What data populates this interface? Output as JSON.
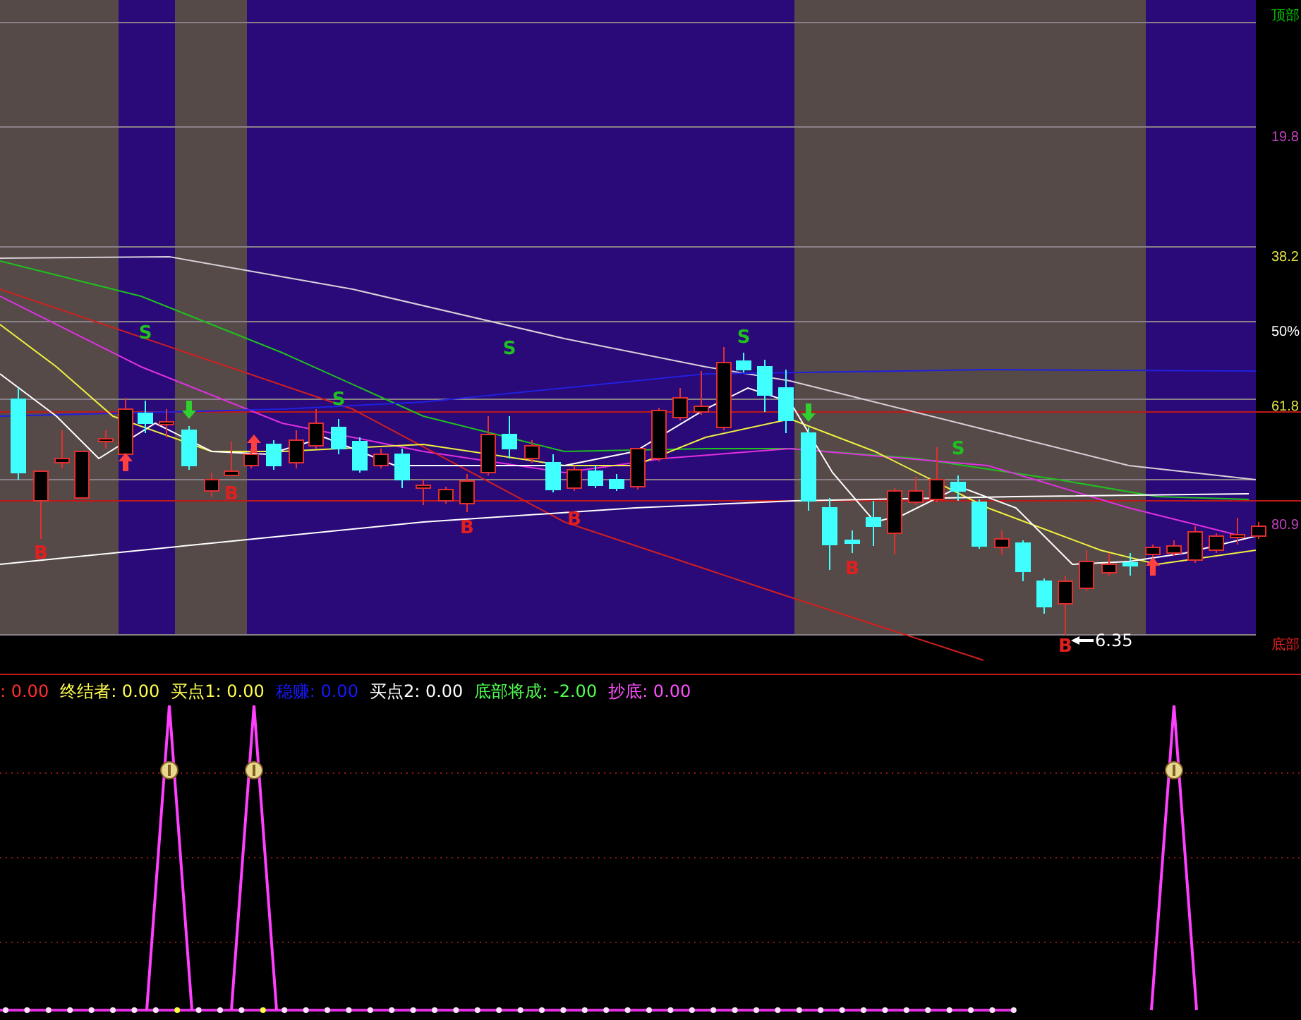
{
  "main_chart": {
    "level_labels": [
      {
        "text": "顶部",
        "color": "#00c000"
      },
      {
        "text": "19.8",
        "color": "#c040c0"
      },
      {
        "text": "38.2",
        "color": "#e0e040"
      },
      {
        "text": "50%",
        "color": "#ffffff"
      },
      {
        "text": "61.8",
        "color": "#e0e040"
      },
      {
        "text": "80.9",
        "color": "#c040c0"
      },
      {
        "text": "底部",
        "color": "#e02020"
      }
    ],
    "signal_marks": [
      {
        "text": "B",
        "kind": "buy"
      },
      {
        "text": "S",
        "kind": "sell"
      },
      {
        "text": "B",
        "kind": "buy"
      },
      {
        "text": "S",
        "kind": "sell"
      },
      {
        "text": "B",
        "kind": "buy"
      },
      {
        "text": "S",
        "kind": "sell"
      },
      {
        "text": "B",
        "kind": "buy"
      },
      {
        "text": "S",
        "kind": "sell"
      },
      {
        "text": "B",
        "kind": "buy"
      },
      {
        "text": "S",
        "kind": "sell"
      },
      {
        "text": "B",
        "kind": "buy"
      }
    ],
    "price_label": "6.35"
  },
  "indicator": {
    "legend": [
      {
        "text": ": 0.00",
        "color": "#ff3030"
      },
      {
        "text": "终结者: 0.00",
        "color": "#ffff50"
      },
      {
        "text": "买点1: 0.00",
        "color": "#ffff50"
      },
      {
        "text": "稳赚: 0.00",
        "color": "#1818ff"
      },
      {
        "text": "买点2: 0.00",
        "color": "#ffffff"
      },
      {
        "text": "底部将成: -2.00",
        "color": "#50ff50"
      },
      {
        "text": "抄底: 0.00",
        "color": "#ff50ff"
      }
    ]
  }
}
